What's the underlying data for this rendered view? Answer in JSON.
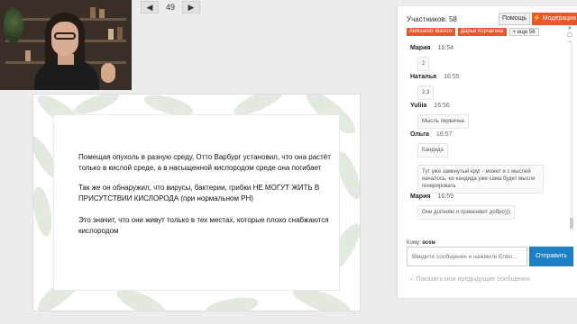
{
  "pager": {
    "prev_icon": "◀",
    "page": "49",
    "next_icon": "▶"
  },
  "slide": {
    "paragraphs": [
      "Помещая опухоль в разную среду, Отто Варбург установил, что она растёт только в кислой среде, а в насыщенной кислородом среде она погибает",
      "Так же он обнаружил, что вирусы, бактерии, грибки НЕ МОГУТ ЖИТЬ В ПРИСУТСТВИИ КИСЛОРОДА (при нормальном PH)",
      "Это значит, что они живут только в тех местах, которые плохо снабжаются кислородом"
    ]
  },
  "chat": {
    "participants": "Участников: 58",
    "help_label": "Помощь",
    "moderation_label": "⚡ Модерация",
    "tags": [
      "Aleksandr Markov",
      "Дарья Корчагина",
      "+ еще 56"
    ],
    "messages": [
      {
        "name": "Мария",
        "time": "16:54",
        "text": "2"
      },
      {
        "name": "Наталья",
        "time": "16:55",
        "text": "2,3"
      },
      {
        "name": "Yuliia",
        "time": "16:56",
        "text": "Мысль первична"
      },
      {
        "name": "Ольга",
        "time": "16:57",
        "text": "Кандида"
      },
      {
        "name": "",
        "time": "",
        "text": "Тут уже замкнутый круг - может и с мыслей началось, но кандида уже сама будет мысли генерировать"
      },
      {
        "name": "Мария",
        "time": "16:59",
        "text": "Они догоняю и приненяют добро)))"
      }
    ],
    "to_label": "Кому:",
    "to_value": "всем",
    "input_placeholder": "Введите сообщение и нажмите Enter...",
    "send_label": "Отправить",
    "previous_link": "Показать мои предыдущие сообщения"
  }
}
